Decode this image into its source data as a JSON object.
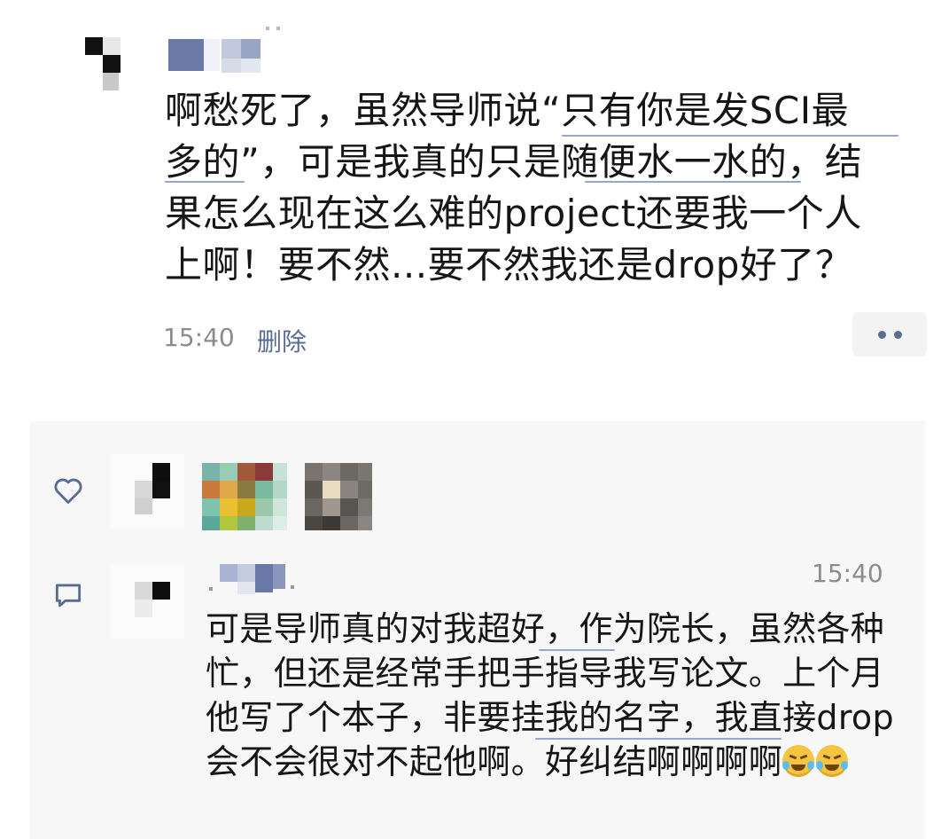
{
  "post": {
    "text": "啊愁死了，虽然导师说“只有你是发SCI最\n多的”，可是我真的只是随便水一水的，结\n果怎么现在这么难的project还要我一个人\n上啊！要不然...要不然我还是drop好了？",
    "time": "15:40",
    "delete_label": "删除"
  },
  "comment": {
    "time": "15:40",
    "text": "可是导师真的对我超好，作为院长，虽然各种忙，但还是经常手把手指导我写论文。上个月他写了个本子，非要挂我的名字，我直接drop会不会很对不起他啊。好纠结啊啊啊啊",
    "emojis": [
      "crying-laugh-emoji",
      "crying-laugh-emoji"
    ]
  },
  "icons": {
    "like": "heart-icon",
    "comment": "comment-bubble-icon",
    "more": "more-dots-icon"
  },
  "colors": {
    "link": "#5a6d95",
    "meta": "#8c8c8c",
    "panel_bg": "#f7f7f7"
  }
}
